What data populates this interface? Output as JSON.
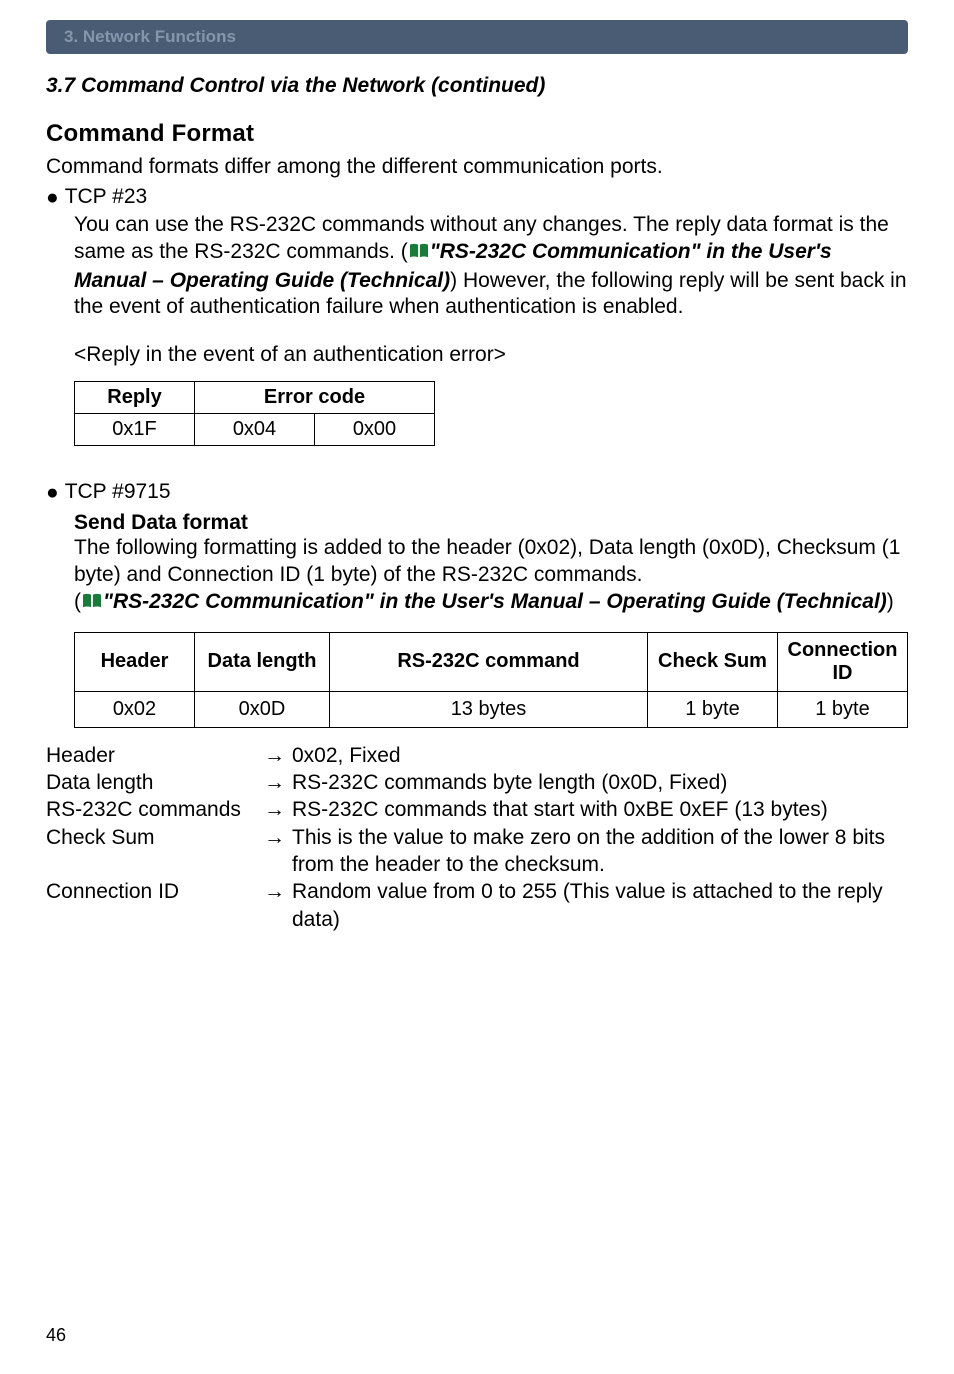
{
  "banner": {
    "label": "3. Network Functions"
  },
  "subtitle": "3.7 Command Control via the Network (continued)",
  "heading_cmdformat": "Command Format",
  "intro_line": "Command formats differ among the different communication ports.",
  "tcp23_bullet": "TCP #23",
  "tcp23_body_1": "You can use the RS-232C commands without any changes. The reply data format is the same as the RS-232C commands. (",
  "ref1": "\"RS-232C Communication\" in the User's Manual – Operating Guide (Technical)",
  "tcp23_body_2": ")",
  "tcp23_body_3": "However, the following reply will be sent back in the event of authentication failure when authentication is enabled.",
  "reply_caption": "<Reply in the event of an authentication error>",
  "reply_table": {
    "headers": {
      "reply": "Reply",
      "error": "Error code"
    },
    "row": {
      "reply": "0x1F",
      "err1": "0x04",
      "err2": "0x00"
    }
  },
  "tcp9715_bullet": "TCP #9715",
  "send_heading": "Send Data format",
  "send_body_1": "The following formatting is added to the header (0x02), Data length (0x0D), Checksum (1 byte) and Connection ID (1 byte) of the RS-232C commands.",
  "send_body_2a": "(",
  "ref2": "\"RS-232C Communication\" in the User's Manual – Operating Guide (Technical)",
  "send_body_2b": ")",
  "data_table": {
    "headers": {
      "header": "Header",
      "dlen": "Data length",
      "cmd": "RS-232C command",
      "csum": "Check Sum",
      "cid": "Connection ID"
    },
    "row": {
      "header": "0x02",
      "dlen": "0x0D",
      "cmd": "13 bytes",
      "csum": "1 byte",
      "cid": "1 byte"
    }
  },
  "fields": [
    {
      "label": "Header",
      "desc": "0x02, Fixed"
    },
    {
      "label": "Data length",
      "desc": "RS-232C commands byte length (0x0D, Fixed)"
    },
    {
      "label": "RS-232C commands",
      "desc": "RS-232C commands that start with 0xBE 0xEF (13 bytes)"
    },
    {
      "label": "Check Sum",
      "desc": "This is the value to make zero on the addition of the lower 8 bits from the header to the checksum."
    },
    {
      "label": "Connection ID",
      "desc": "Random value from 0 to 255 (This value is attached to the reply data)"
    }
  ],
  "arrow_glyph": "→",
  "page_number": "46",
  "icons": {
    "book_color": "#1a7a3a"
  }
}
